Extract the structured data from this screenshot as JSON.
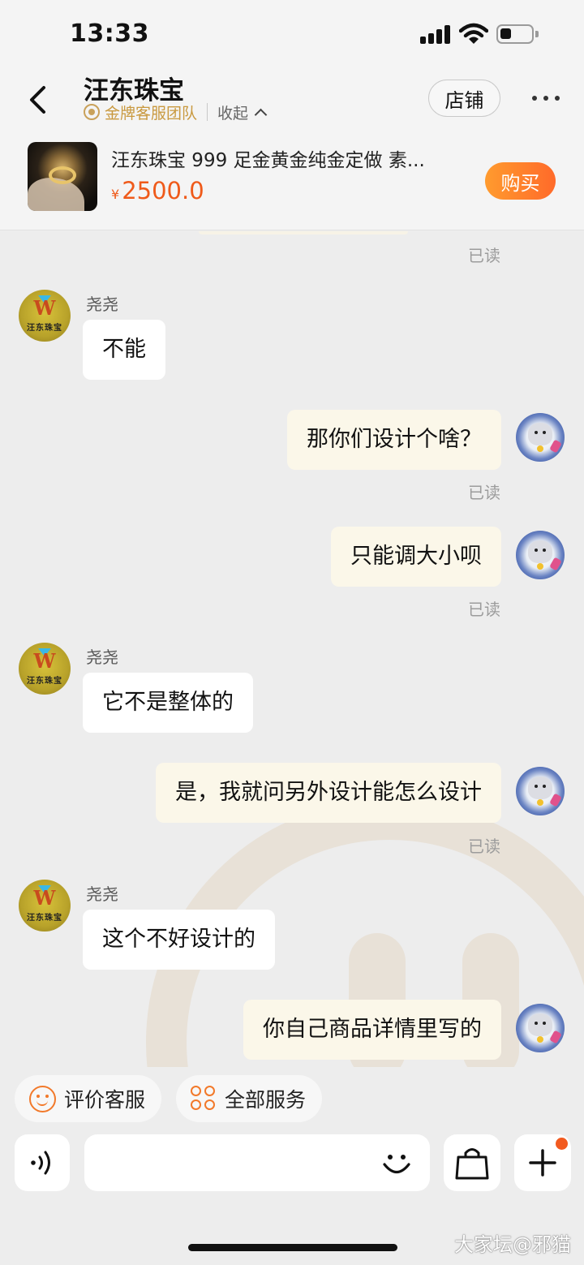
{
  "status": {
    "time": "13:33"
  },
  "header": {
    "shop_name": "汪东珠宝",
    "team": "金牌客服团队",
    "collapse": "收起",
    "store_button": "店铺"
  },
  "product": {
    "title": "汪东珠宝 999 足金黄金纯金定做 素...",
    "currency": "¥",
    "price": "2500.0",
    "buy_button": "购买"
  },
  "messages": [
    {
      "side": "right",
      "read": "已读"
    },
    {
      "side": "left",
      "sender": "尧尧",
      "text": "不能"
    },
    {
      "side": "right",
      "text": "那你们设计个啥？",
      "read": "已读"
    },
    {
      "side": "right",
      "text": "只能调大小呗",
      "read": "已读"
    },
    {
      "side": "left",
      "sender": "尧尧",
      "text": "它不是整体的"
    },
    {
      "side": "right",
      "text": "是，我就问另外设计能怎么设计",
      "read": "已读"
    },
    {
      "side": "left",
      "sender": "尧尧",
      "text": "这个不好设计的"
    },
    {
      "side": "right",
      "text": "你自己商品详情里写的"
    }
  ],
  "agent_avatar_text": "汪东珠宝",
  "quick_actions": {
    "rate": "评价客服",
    "all_services": "全部服务"
  },
  "input": {
    "placeholder": ""
  },
  "watermark": "大家坛@邪猫",
  "colors": {
    "accent": "#f2792a",
    "price": "#ef5a1a",
    "gold": "#c9993f",
    "bubble_right": "#fbf7e9"
  }
}
